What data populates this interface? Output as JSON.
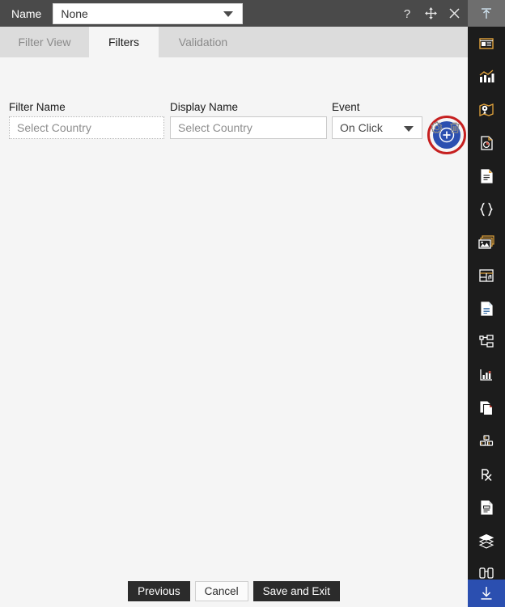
{
  "header": {
    "name_label": "Name",
    "name_value": "None",
    "tools": [
      {
        "icon": "help-icon",
        "glyph": "?"
      },
      {
        "icon": "move-icon",
        "glyph": "move"
      },
      {
        "icon": "close-icon",
        "glyph": "close"
      }
    ]
  },
  "tabs": [
    {
      "label": "Filter View",
      "active": false
    },
    {
      "label": "Filters",
      "active": true
    },
    {
      "label": "Validation",
      "active": false
    }
  ],
  "content": {
    "add_button_icon": "plus-circle-icon",
    "columns": {
      "filter_name": "Filter Name",
      "display_name": "Display Name",
      "event": "Event"
    },
    "rows": [
      {
        "filter_name": "Select Country",
        "display_name": "Select Country",
        "event": "On Click",
        "settings_icon": "gear-icon",
        "delete_icon": "trash-icon"
      }
    ]
  },
  "footer": {
    "previous": "Previous",
    "cancel": "Cancel",
    "save_and_exit": "Save and Exit"
  },
  "sidebar": {
    "top_icon": "collapse-up-icon",
    "items": [
      {
        "icon": "window-card-icon"
      },
      {
        "icon": "chart-bar-line-icon"
      },
      {
        "icon": "map-pin-icon"
      },
      {
        "icon": "document-pie-icon"
      },
      {
        "icon": "document-text-icon"
      },
      {
        "icon": "curly-braces-icon"
      },
      {
        "icon": "image-stack-icon"
      },
      {
        "icon": "table-grid-icon"
      },
      {
        "icon": "document-lines-icon"
      },
      {
        "icon": "tree-hierarchy-icon"
      },
      {
        "icon": "bar-chart-axis-icon"
      },
      {
        "icon": "document-copy-icon"
      },
      {
        "icon": "cubes-icon"
      },
      {
        "icon": "rx-icon"
      },
      {
        "icon": "clipboard-report-icon"
      },
      {
        "icon": "layers-icon"
      },
      {
        "icon": "binoculars-icon"
      }
    ],
    "bottom_icon": "download-icon",
    "accent_color": "#2b4fb0"
  },
  "colors": {
    "header_bg": "#4a4a4a",
    "tab_inactive_bg": "#dcdcdc",
    "content_bg": "#f5f5f5",
    "sidebar_bg": "#1c1c1c",
    "accent_blue": "#2b4fb0",
    "annotation_red": "#c62020",
    "button_dark": "#2b2b2b"
  }
}
